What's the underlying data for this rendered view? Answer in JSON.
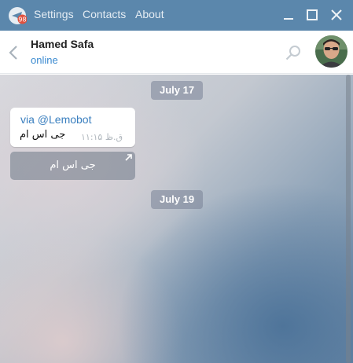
{
  "app": {
    "badge": "98",
    "menu": [
      "Settings",
      "Contacts",
      "About"
    ]
  },
  "header": {
    "name": "Hamed Safa",
    "status": "online"
  },
  "chat": {
    "dates": [
      "July 17",
      "July 19"
    ],
    "message": {
      "via": "via @Lemobot",
      "text": "جی اس ام",
      "time": "۱۱:۱۵ ق.ظ"
    },
    "inline_button": "جی اس ام"
  },
  "colors": {
    "titlebar": "#5b87ac",
    "accent": "#3a8ad0",
    "badge": "#e0513f"
  }
}
